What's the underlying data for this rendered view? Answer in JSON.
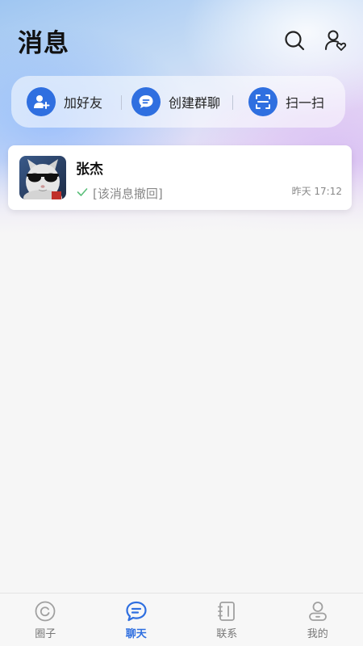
{
  "header": {
    "title": "消息",
    "icons": [
      "search-icon",
      "user-heart-icon"
    ]
  },
  "quick_actions": [
    {
      "label": "加好友",
      "icon": "add-user-icon"
    },
    {
      "label": "创建群聊",
      "icon": "group-chat-icon"
    },
    {
      "label": "扫一扫",
      "icon": "scan-icon"
    }
  ],
  "chats": [
    {
      "name": "张杰",
      "preview": "[该消息撤回]",
      "time": "昨天 17:12",
      "status_icon": "check-icon",
      "avatar": "cat-with-sunglasses"
    }
  ],
  "tabs": [
    {
      "label": "圈子",
      "icon": "circle-icon",
      "active": false
    },
    {
      "label": "聊天",
      "icon": "chat-icon",
      "active": true
    },
    {
      "label": "联系",
      "icon": "contacts-book-icon",
      "active": false
    },
    {
      "label": "我的",
      "icon": "profile-icon",
      "active": false
    }
  ],
  "colors": {
    "accent": "#2f6fe0",
    "inactive": "#9a9a9a"
  }
}
